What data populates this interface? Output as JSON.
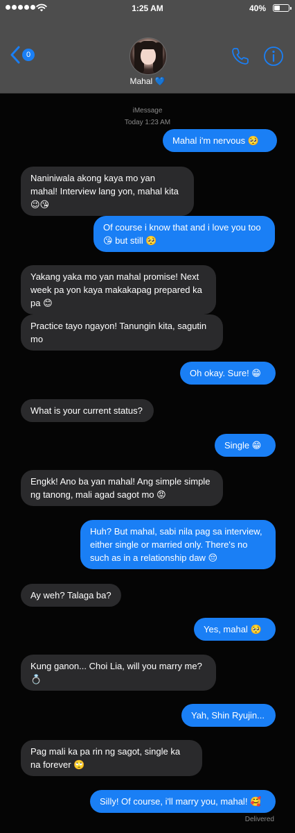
{
  "status_bar": {
    "time": "1:25 AM",
    "battery_percent": "40%",
    "battery_level": 0.4,
    "signal_bars": 5
  },
  "header": {
    "back_badge": "0",
    "contact_name": "Mahal",
    "contact_emoji": "💙"
  },
  "chat": {
    "service": "iMessage",
    "timestamp_day": "Today",
    "timestamp_time": "1:23 AM",
    "delivered_label": "Delivered",
    "messages": [
      {
        "dir": "out",
        "text": "Mahal i'm nervous 🥺"
      },
      {
        "dir": "in",
        "text": "Naniniwala akong kaya mo yan mahal! Interview lang yon, mahal kita 😉😘"
      },
      {
        "dir": "out",
        "text": "Of course i know that and i love you too 😘 but still 🥺"
      },
      {
        "dir": "in",
        "text": "Yakang yaka mo yan mahal promise! Next week pa yon kaya makakapag prepared ka pa 😊"
      },
      {
        "dir": "in",
        "text": "Practice tayo ngayon! Tanungin kita, sagutin mo"
      },
      {
        "dir": "out",
        "text": "Oh okay. Sure! 😁"
      },
      {
        "dir": "in",
        "text": "What is your current status?"
      },
      {
        "dir": "out",
        "text": "Single 😁"
      },
      {
        "dir": "in",
        "text": "Engkk! Ano ba yan mahal! Ang simple simple ng tanong, mali agad sagot mo 😡"
      },
      {
        "dir": "out",
        "text": "Huh? But mahal, sabi nila pag sa interview, either single or married only. There's no such as in a relationship daw 😔"
      },
      {
        "dir": "in",
        "text": "Ay weh? Talaga ba?"
      },
      {
        "dir": "out",
        "text": "Yes, mahal 🥺"
      },
      {
        "dir": "in",
        "text": "Kung ganon... Choi Lia, will you marry me? 💍"
      },
      {
        "dir": "out",
        "text": "Yah, Shin Ryujin..."
      },
      {
        "dir": "in",
        "text": "Pag mali ka pa rin ng sagot, single ka na forever 🙄"
      },
      {
        "dir": "out",
        "text": "Silly! Of course, i'll marry you, mahal! 🥰"
      }
    ]
  },
  "colors": {
    "header_bg": "#4d4d4d",
    "outgoing_bubble": "#1a7ff5",
    "incoming_bubble": "#2a2a2c",
    "background": "#050505",
    "meta_text": "#8a8a8a",
    "accent": "#1a7ff5"
  }
}
